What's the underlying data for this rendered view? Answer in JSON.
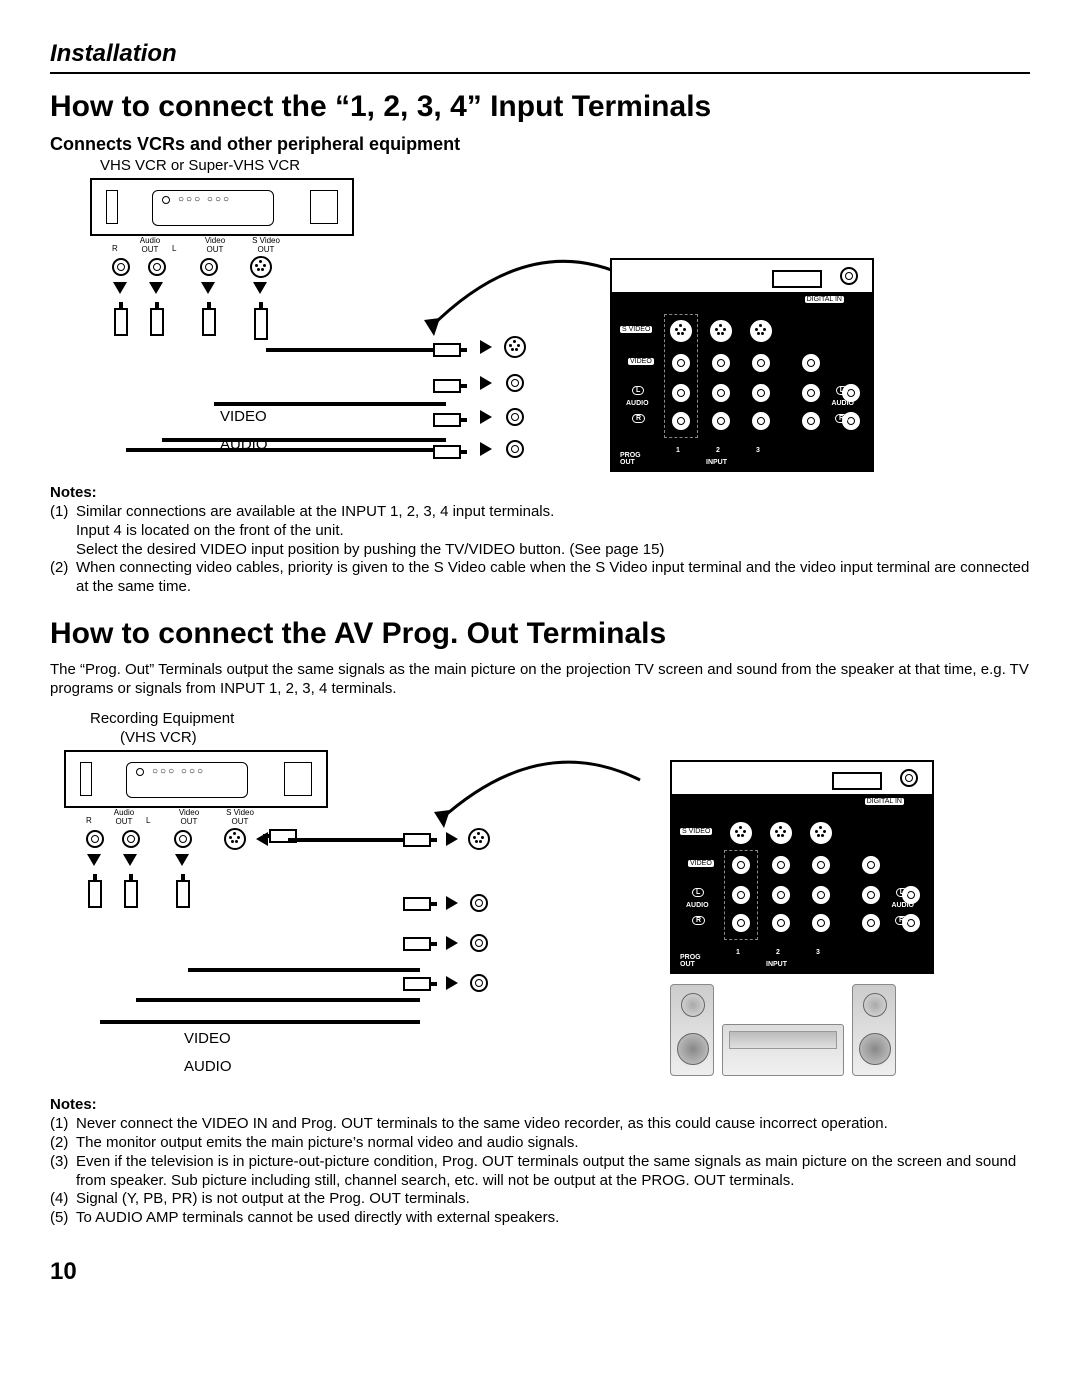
{
  "section": "Installation",
  "title1": "How to connect the “1, 2, 3, 4” Input Terminals",
  "subhead1": "Connects VCRs and other peripheral equipment",
  "caption1": "VHS VCR or Super-VHS VCR",
  "vcr_ports": {
    "audio_out": "Audio\nOUT",
    "r": "R",
    "l": "L",
    "video_out": "Video\nOUT",
    "svideo_out": "S Video\nOUT"
  },
  "cable_labels": {
    "video": "VIDEO",
    "audio": "AUDIO"
  },
  "tv_panel": {
    "digital_in": "DIGITAL IN",
    "s_video": "S VIDEO",
    "video": "VIDEO",
    "audio": "AUDIO",
    "l": "L",
    "r": "R",
    "prog_out": "PROG\nOUT",
    "input": "INPUT",
    "n1": "1",
    "n2": "2",
    "n3": "3"
  },
  "notes1_label": "Notes:",
  "notes1": [
    {
      "n": "(1)",
      "t": "Similar connections are available at the INPUT 1, 2, 3, 4 input terminals.\nInput 4 is located on the front of the unit.\nSelect the desired VIDEO input position by pushing the TV/VIDEO button. (See page 15)"
    },
    {
      "n": "(2)",
      "t": "When connecting video cables, priority is given to the S Video cable when the S Video input terminal and the video input terminal are connected at the same time."
    }
  ],
  "title2": "How to connect the AV Prog. Out Terminals",
  "para2": "The “Prog. Out” Terminals output the same signals as the main picture on the projection TV screen and sound from the speaker at that time, e.g. TV programs or signals from INPUT 1, 2, 3, 4 terminals.",
  "caption2a": "Recording Equipment",
  "caption2b": "(VHS VCR)",
  "notes2_label": "Notes:",
  "notes2": [
    {
      "n": "(1)",
      "t": "Never connect the VIDEO IN and Prog. OUT terminals to the same video recorder, as this could cause incorrect operation."
    },
    {
      "n": "(2)",
      "t": "The monitor output emits the main picture’s normal video and audio signals."
    },
    {
      "n": "(3)",
      "t": "Even if the television is in picture-out-picture condition, Prog. OUT terminals output the same signals as main picture on the screen and sound from speaker. Sub picture including still, channel search, etc. will not be output at the PROG. OUT terminals."
    },
    {
      "n": "(4)",
      "t": "Signal (Y, PB, PR) is not output at the Prog. OUT terminals."
    },
    {
      "n": "(5)",
      "t": "To AUDIO AMP terminals cannot be used directly with external speakers."
    }
  ],
  "page_number": "10"
}
